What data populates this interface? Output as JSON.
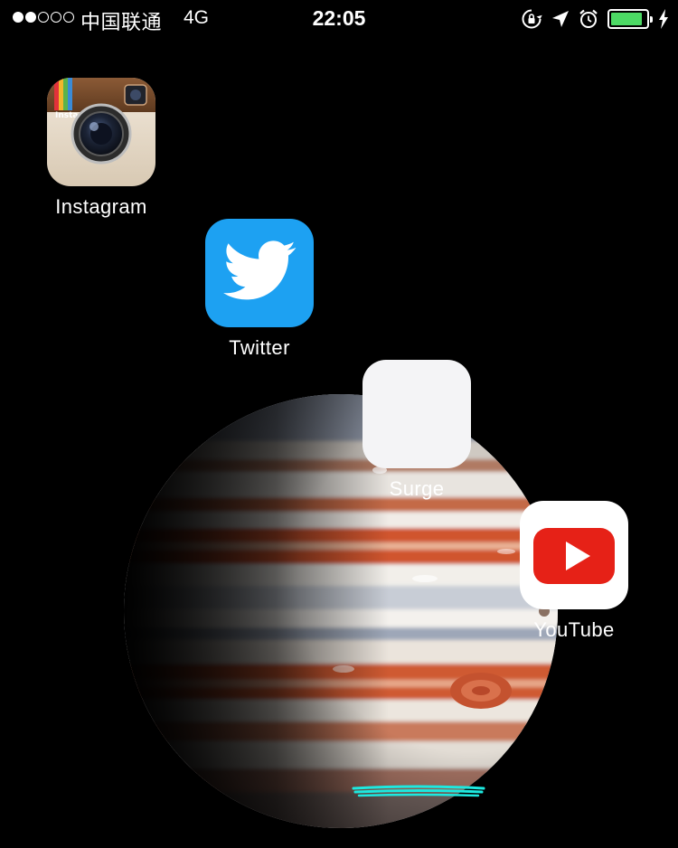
{
  "status_bar": {
    "signal_dots_filled": 2,
    "signal_dots_total": 5,
    "carrier": "中国联通",
    "network": "4G",
    "time": "22:05",
    "icons": [
      "rotation-lock-icon",
      "location-arrow-icon",
      "alarm-icon",
      "battery-icon",
      "charging-bolt-icon"
    ],
    "battery_level": 0.9,
    "battery_color": "#4cd964"
  },
  "apps": [
    {
      "label": "Instagram",
      "icon": "instagram-camera-icon"
    },
    {
      "label": "Twitter",
      "icon": "twitter-bird-icon",
      "color": "#1da1f2"
    },
    {
      "label": "Surge",
      "icon": "surge-bars-icon"
    },
    {
      "label": "YouTube",
      "icon": "youtube-play-icon",
      "color": "#e62117"
    }
  ],
  "annotation": {
    "color": "#1de9e0"
  },
  "wallpaper": {
    "subject": "jupiter-planet"
  }
}
